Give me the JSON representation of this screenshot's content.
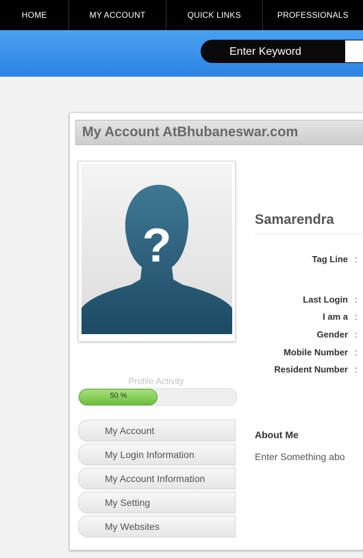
{
  "nav": {
    "items": [
      {
        "label": "HOME"
      },
      {
        "label": "MY ACCOUNT"
      },
      {
        "label": "QUICK LINKS"
      },
      {
        "label": "PROFESSIONALS"
      }
    ]
  },
  "search": {
    "label": "Enter Keyword"
  },
  "panel": {
    "title": "My Account AtBhubaneswar.com"
  },
  "profile": {
    "activity_label": "Profile Activity",
    "activity_percent": 50,
    "activity_text": "50 %"
  },
  "menu": {
    "items": [
      {
        "label": "My Account"
      },
      {
        "label": "My Login Information"
      },
      {
        "label": "My Account Information"
      },
      {
        "label": "My Setting"
      },
      {
        "label": "My Websites"
      }
    ]
  },
  "user": {
    "name": "Samarendra",
    "fields": [
      {
        "label": "Tag Line"
      },
      {
        "label": "Last Login"
      },
      {
        "label": "I am a"
      },
      {
        "label": "Gender"
      },
      {
        "label": "Mobile Number"
      },
      {
        "label": "Resident Number"
      }
    ]
  },
  "about": {
    "heading": "About Me",
    "text": "Enter Something abo"
  },
  "colors": {
    "nav_bg": "#000000",
    "search_band": "#2c83e3",
    "progress_fill": "#6cbf3d"
  }
}
